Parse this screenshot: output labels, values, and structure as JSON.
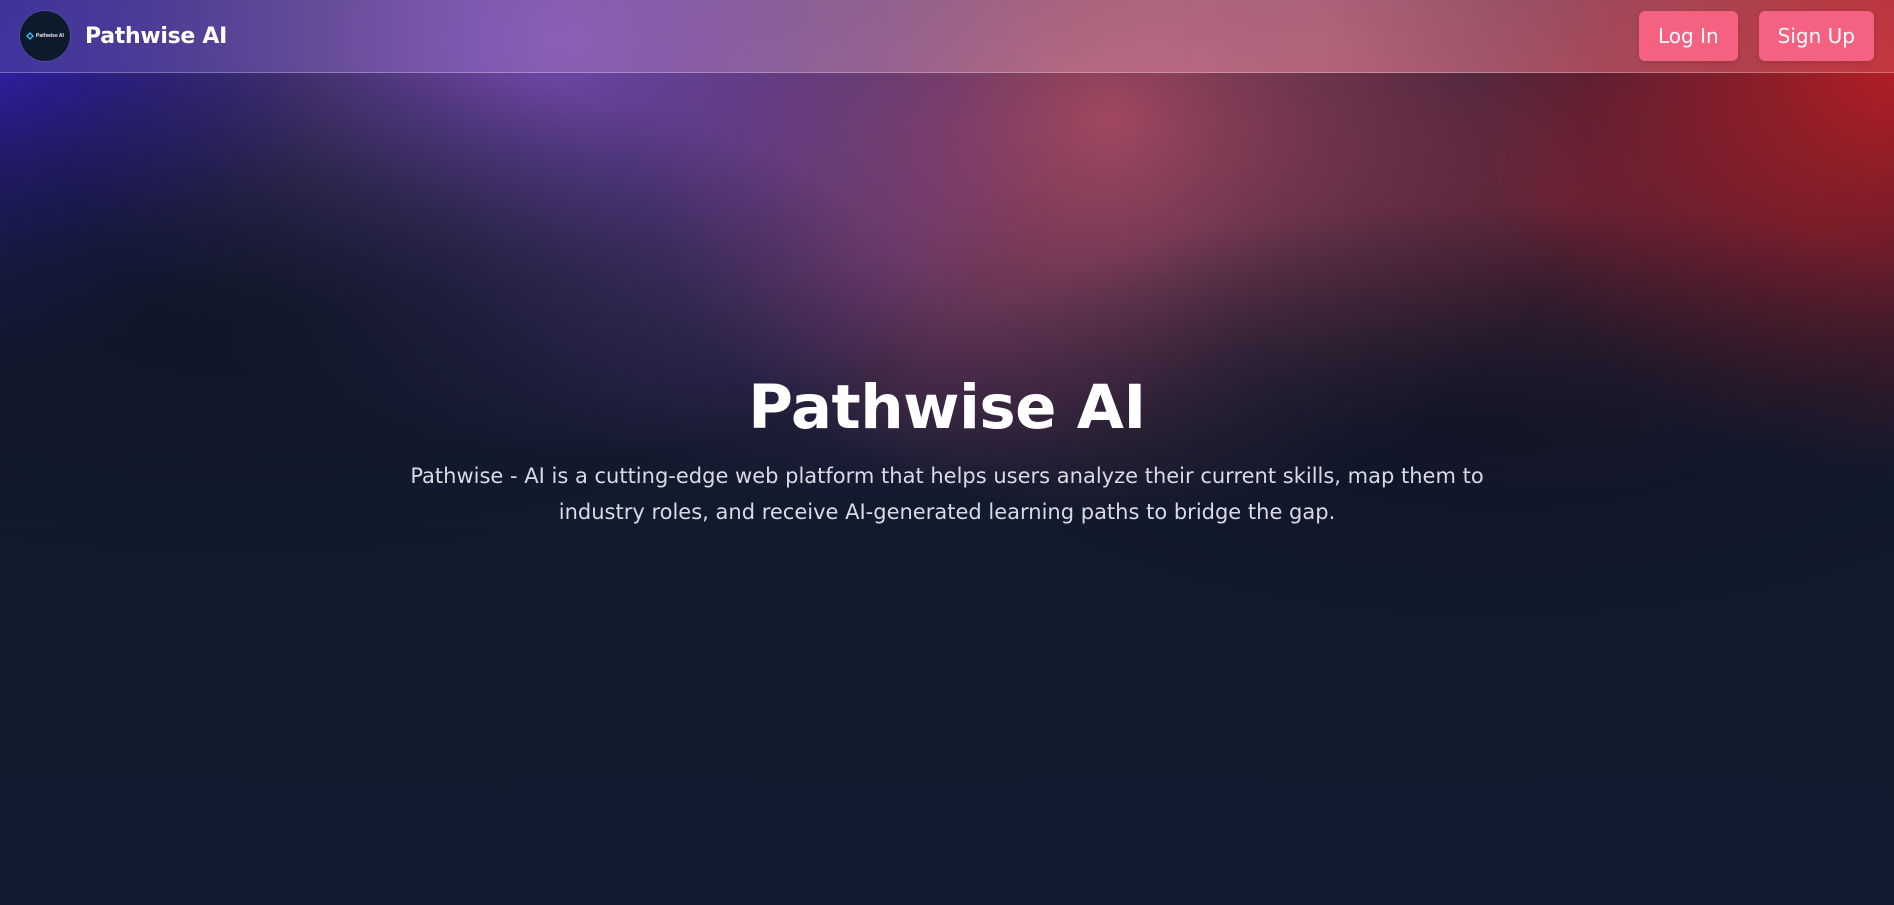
{
  "navbar": {
    "logo": {
      "icon": "diamond-logo-icon",
      "text": "Pathwise AI",
      "accent_color": "#38bdf8"
    },
    "brand_name": "Pathwise AI",
    "login_label": "Log In",
    "signup_label": "Sign Up",
    "button_color": "#f56181"
  },
  "hero": {
    "title": "Pathwise AI",
    "description": "Pathwise - AI is a cutting-edge web platform that helps users analyze their current skills, map them to industry roles, and receive AI-generated learning paths to bridge the gap."
  },
  "theme": {
    "background": "#111a2e",
    "text_primary": "#ffffff",
    "text_secondary": "#d9dbe4"
  }
}
